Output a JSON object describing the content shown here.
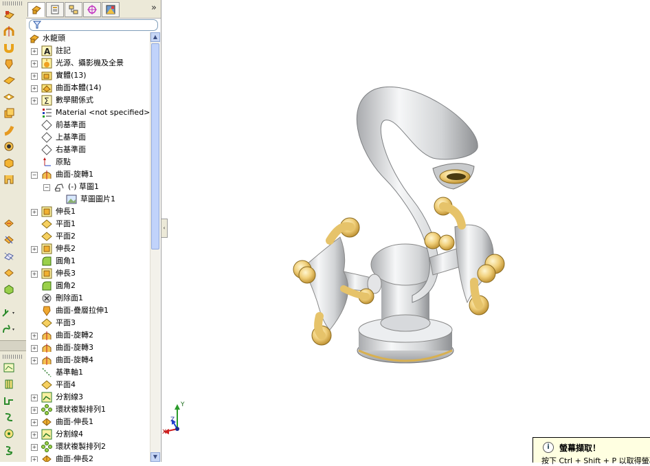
{
  "tree": {
    "root_label": "水龍頭",
    "items": [
      {
        "label": "註記",
        "icon": "annotation-icon",
        "expandable": true,
        "expanded": false,
        "level": 1
      },
      {
        "label": "光源、攝影機及全景",
        "icon": "lights-icon",
        "expandable": true,
        "expanded": false,
        "level": 1
      },
      {
        "label": "實體(13)",
        "icon": "solid-bodies-folder-icon",
        "expandable": true,
        "expanded": false,
        "level": 1
      },
      {
        "label": "曲面本體(14)",
        "icon": "surface-bodies-folder-icon",
        "expandable": true,
        "expanded": false,
        "level": 1
      },
      {
        "label": "數學關係式",
        "icon": "equations-icon",
        "expandable": true,
        "expanded": false,
        "level": 1
      },
      {
        "label": "Material <not specified>",
        "icon": "material-icon",
        "expandable": false,
        "expanded": false,
        "level": 1
      },
      {
        "label": "前基準面",
        "icon": "plane-icon",
        "expandable": false,
        "expanded": false,
        "level": 1
      },
      {
        "label": "上基準面",
        "icon": "plane-icon",
        "expandable": false,
        "expanded": false,
        "level": 1
      },
      {
        "label": "右基準面",
        "icon": "plane-icon",
        "expandable": false,
        "expanded": false,
        "level": 1
      },
      {
        "label": "原點",
        "icon": "origin-icon",
        "expandable": false,
        "expanded": false,
        "level": 1
      },
      {
        "label": "曲面-旋轉1",
        "icon": "surface-revolve-icon",
        "expandable": true,
        "expanded": true,
        "level": 1
      },
      {
        "label": "(-) 草圖1",
        "icon": "sketch-icon",
        "expandable": true,
        "expanded": true,
        "level": 2
      },
      {
        "label": "草圖圖片1",
        "icon": "sketch-picture-icon",
        "expandable": false,
        "expanded": false,
        "level": 3
      },
      {
        "label": "伸長1",
        "icon": "extrude-icon",
        "expandable": true,
        "expanded": false,
        "level": 1
      },
      {
        "label": "平面1",
        "icon": "plane-feature-icon",
        "expandable": false,
        "expanded": false,
        "level": 1
      },
      {
        "label": "平面2",
        "icon": "plane-feature-icon",
        "expandable": false,
        "expanded": false,
        "level": 1
      },
      {
        "label": "伸長2",
        "icon": "extrude-icon",
        "expandable": true,
        "expanded": false,
        "level": 1
      },
      {
        "label": "圓角1",
        "icon": "fillet-icon",
        "expandable": false,
        "expanded": false,
        "level": 1
      },
      {
        "label": "伸長3",
        "icon": "extrude-icon",
        "expandable": true,
        "expanded": false,
        "level": 1
      },
      {
        "label": "圓角2",
        "icon": "fillet-icon",
        "expandable": false,
        "expanded": false,
        "level": 1
      },
      {
        "label": "刪除面1",
        "icon": "delete-face-icon",
        "expandable": false,
        "expanded": false,
        "level": 1
      },
      {
        "label": "曲面-疊層拉伸1",
        "icon": "surface-loft-icon",
        "expandable": false,
        "expanded": false,
        "level": 1
      },
      {
        "label": "平面3",
        "icon": "plane-feature-icon",
        "expandable": false,
        "expanded": false,
        "level": 1
      },
      {
        "label": "曲面-旋轉2",
        "icon": "surface-revolve-icon",
        "expandable": true,
        "expanded": false,
        "level": 1
      },
      {
        "label": "曲面-旋轉3",
        "icon": "surface-revolve-icon",
        "expandable": true,
        "expanded": false,
        "level": 1
      },
      {
        "label": "曲面-旋轉4",
        "icon": "surface-revolve-icon",
        "expandable": true,
        "expanded": false,
        "level": 1
      },
      {
        "label": "基準軸1",
        "icon": "axis-icon",
        "expandable": false,
        "expanded": false,
        "level": 1
      },
      {
        "label": "平面4",
        "icon": "plane-feature-icon",
        "expandable": false,
        "expanded": false,
        "level": 1
      },
      {
        "label": "分割線3",
        "icon": "split-line-icon",
        "expandable": true,
        "expanded": false,
        "level": 1
      },
      {
        "label": "環狀複製排列1",
        "icon": "circular-pattern-icon",
        "expandable": true,
        "expanded": false,
        "level": 1
      },
      {
        "label": "曲面-伸長1",
        "icon": "surface-extrude-icon",
        "expandable": true,
        "expanded": false,
        "level": 1
      },
      {
        "label": "分割線4",
        "icon": "split-line-icon",
        "expandable": true,
        "expanded": false,
        "level": 1
      },
      {
        "label": "環狀複製排列2",
        "icon": "circular-pattern-icon",
        "expandable": true,
        "expanded": false,
        "level": 1
      },
      {
        "label": "曲面-伸長2",
        "icon": "surface-extrude-icon",
        "expandable": true,
        "expanded": false,
        "level": 1
      }
    ]
  },
  "triad": {
    "x": "X",
    "y": "Y",
    "z": "Z"
  },
  "tooltip": {
    "title": "螢幕擷取！",
    "body": "按下 Ctrl + Shift + P 以取得螢幕"
  },
  "colors": {
    "toolbar_bg": "#ece9d8",
    "chrome": "#e8ebee",
    "gold": "#e6c36a",
    "tooltip_bg": "#ffffe1"
  }
}
